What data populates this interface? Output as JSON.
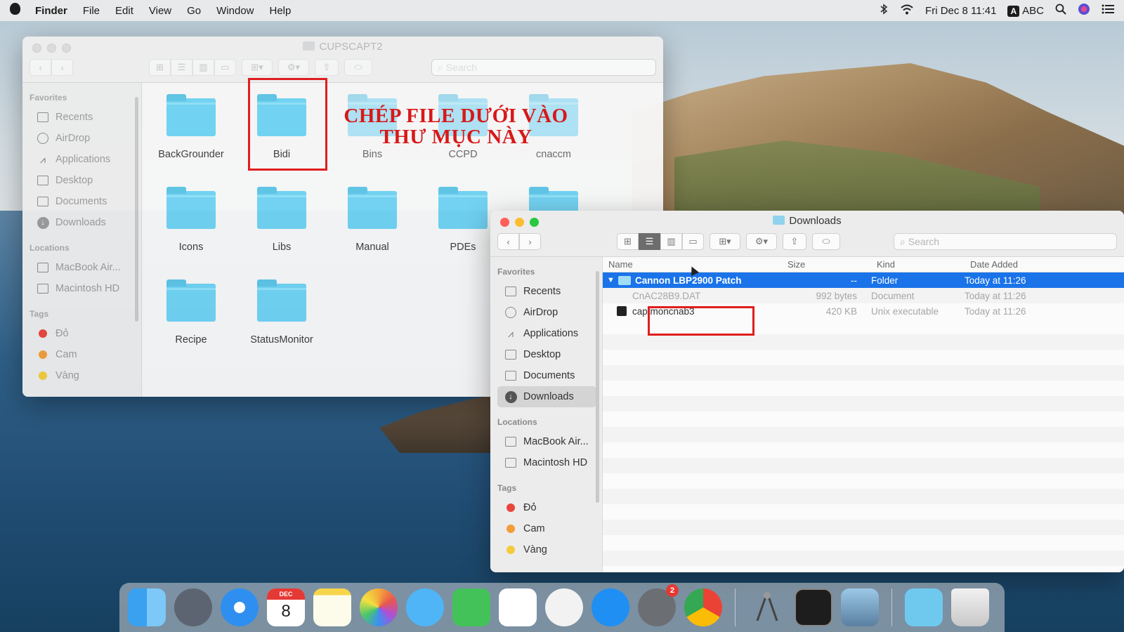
{
  "menubar": {
    "app": "Finder",
    "items": [
      "File",
      "Edit",
      "View",
      "Go",
      "Window",
      "Help"
    ],
    "clock": "Fri Dec 8  11:41",
    "input_source": "ABC",
    "input_badge": "A"
  },
  "window_back": {
    "title": "CUPSCAPT2",
    "search_placeholder": "Search",
    "sidebar": {
      "favorites_heading": "Favorites",
      "favorites": [
        "Recents",
        "AirDrop",
        "Applications",
        "Desktop",
        "Documents",
        "Downloads"
      ],
      "locations_heading": "Locations",
      "locations": [
        "MacBook Air...",
        "Macintosh HD"
      ],
      "tags_heading": "Tags",
      "tags": [
        {
          "name": "Đỏ",
          "color": "#e8453c"
        },
        {
          "name": "Cam",
          "color": "#f29d38"
        },
        {
          "name": "Vàng",
          "color": "#f3cb3a"
        }
      ]
    },
    "folders": [
      "BackGrounder",
      "Bidi",
      "Bins",
      "CCPD",
      "cnaccm",
      "Icons",
      "Libs",
      "Manual",
      "PDEs",
      "",
      "Recipe",
      "StatusMonitor"
    ]
  },
  "annotation": {
    "line1": "CHÉP FILE DƯỚI VÀO",
    "line2": "THƯ MỤC NÀY",
    "color": "#e01e1e"
  },
  "window_front": {
    "title": "Downloads",
    "search_placeholder": "Search",
    "sidebar": {
      "favorites_heading": "Favorites",
      "favorites": [
        "Recents",
        "AirDrop",
        "Applications",
        "Desktop",
        "Documents",
        "Downloads"
      ],
      "locations_heading": "Locations",
      "locations": [
        "MacBook Air...",
        "Macintosh HD"
      ],
      "tags_heading": "Tags",
      "tags": [
        {
          "name": "Đỏ",
          "color": "#e8453c"
        },
        {
          "name": "Cam",
          "color": "#f29d38"
        },
        {
          "name": "Vàng",
          "color": "#f3cb3a"
        }
      ]
    },
    "columns": [
      "Name",
      "Size",
      "Kind",
      "Date Added"
    ],
    "rows": [
      {
        "name": "Cannon LBP2900 Patch",
        "size": "--",
        "kind": "Folder",
        "date": "Today at 11:26"
      },
      {
        "name": "CnAC28B9.DAT",
        "size": "992 bytes",
        "kind": "Document",
        "date": "Today at 11:26"
      },
      {
        "name": "captmoncnab3",
        "size": "420 KB",
        "kind": "Unix executable",
        "date": "Today at 11:26"
      }
    ]
  },
  "dock": {
    "calendar_month": "DEC",
    "calendar_day": "8",
    "settings_badge": "2",
    "apps": [
      "finder-icon",
      "launchpad-icon",
      "safari-icon",
      "calendar-icon",
      "notes-icon",
      "photos-icon",
      "messages-icon",
      "facetime-icon",
      "reminders-icon",
      "music-icon",
      "app-store-icon",
      "system-preferences-icon",
      "chrome-icon",
      "xcode-instruments-icon",
      "terminal-icon",
      "preview-icon",
      "downloads-stack-icon",
      "trash-icon"
    ]
  }
}
